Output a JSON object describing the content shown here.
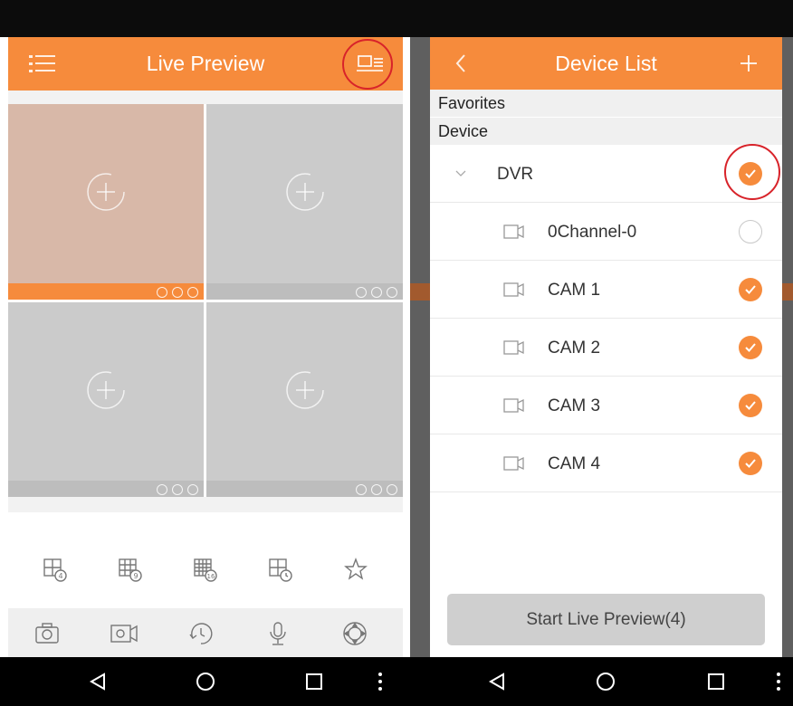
{
  "left_screen": {
    "header": {
      "title": "Live Preview"
    },
    "grid": {
      "cells": 4
    },
    "split_buttons": [
      "4",
      "9",
      "16"
    ],
    "toolbar_icons": [
      "camera-icon",
      "video-record-icon",
      "playback-icon",
      "microphone-icon",
      "ptz-icon"
    ]
  },
  "right_screen": {
    "header": {
      "title": "Device List"
    },
    "sections": {
      "favorites": "Favorites",
      "device": "Device"
    },
    "dvr": {
      "label": "DVR",
      "checked": true
    },
    "channels": [
      {
        "label": "0Channel-0",
        "checked": false
      },
      {
        "label": "CAM 1",
        "checked": true
      },
      {
        "label": "CAM 2",
        "checked": true
      },
      {
        "label": "CAM 3",
        "checked": true
      },
      {
        "label": "CAM 4",
        "checked": true
      }
    ],
    "start_button": "Start Live Preview(4)"
  },
  "colors": {
    "accent": "#f68b3c",
    "highlight": "#d8232a"
  }
}
